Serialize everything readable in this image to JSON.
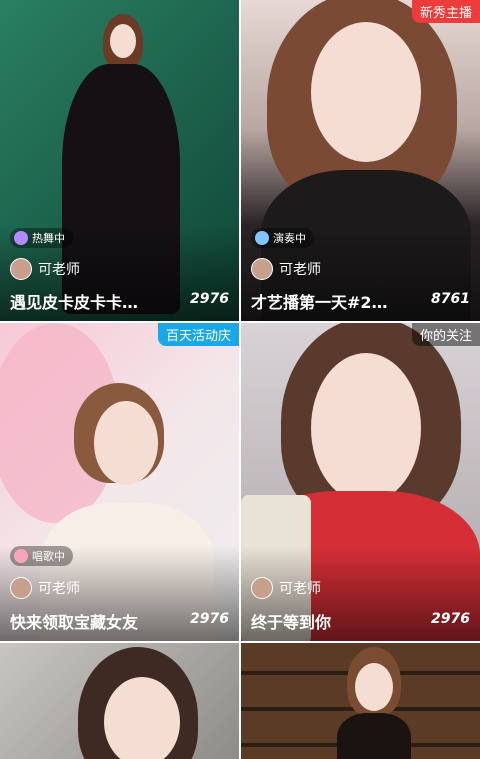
{
  "cards": [
    {
      "corner_badge": "",
      "status_label": "热舞中",
      "owner_name": "可老师",
      "title": "遇见皮卡皮卡卡…",
      "viewer_count": "2976"
    },
    {
      "corner_badge": "新秀主播",
      "status_label": "演奏中",
      "owner_name": "可老师",
      "title": "才艺播第一天#2…",
      "viewer_count": "8761"
    },
    {
      "corner_badge": "百天活动庆",
      "status_label": "唱歌中",
      "owner_name": "可老师",
      "title": "快来领取宝藏女友",
      "viewer_count": "2976"
    },
    {
      "corner_badge": "你的关注",
      "status_label": "",
      "owner_name": "可老师",
      "title": "终于等到你",
      "viewer_count": "2976"
    }
  ],
  "colors": {
    "badge_new": "#ee3b3b",
    "badge_event": "#1aa7e8",
    "badge_follow": "rgba(0,0,0,0.45)",
    "card1_bg": "#1e6b54",
    "card2_bg": "#2a2326",
    "card3_bg": "#f1d6de",
    "card4_bg": "#c5c1c4"
  },
  "icons": [
    "dance-icon",
    "instrument-icon",
    "sing-icon"
  ]
}
